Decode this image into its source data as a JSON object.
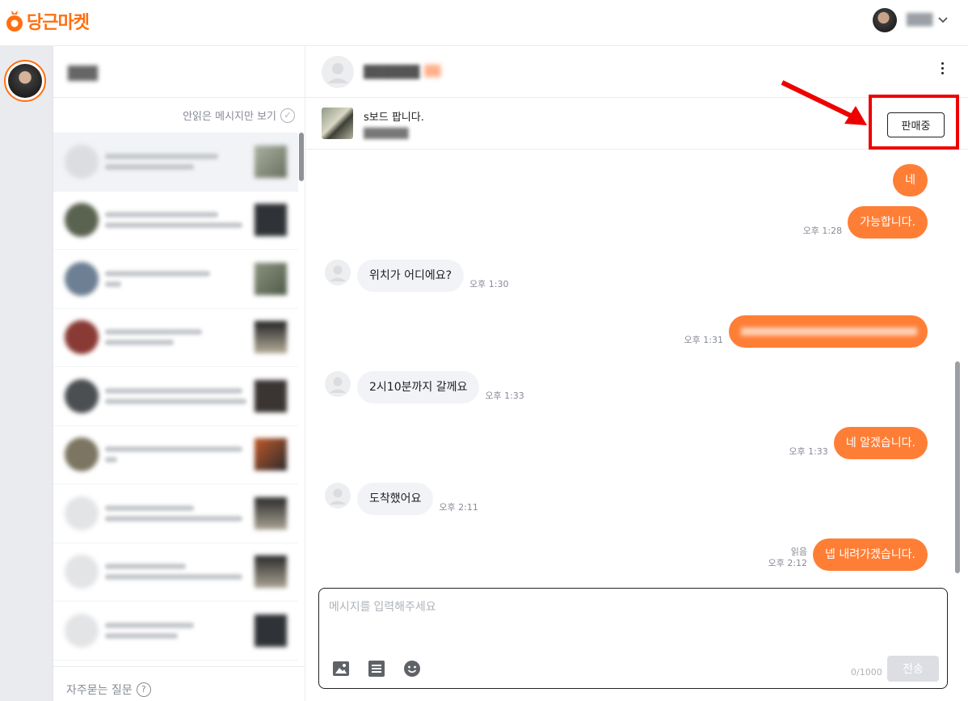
{
  "app": {
    "logo_text": "당근마켓",
    "brand_color": "#ff6f0f"
  },
  "topbar": {
    "user_name": "███"
  },
  "chat_list": {
    "title": "███",
    "unread_only_label": "안읽은 메시지만 보기",
    "faq_label": "자주묻는 질문",
    "item_count": 9
  },
  "chat": {
    "partner_name": "██████",
    "partner_temp": "██",
    "item": {
      "title": "s보드 팝니다.",
      "price": "██████"
    },
    "status_button": "판매중",
    "messages": [
      {
        "from": "me",
        "text": "네",
        "time": ""
      },
      {
        "from": "me",
        "text": "가능합니다.",
        "time": "오후 1:28"
      },
      {
        "from": "them",
        "text": "위치가 어디에요?",
        "time": "오후 1:30"
      },
      {
        "from": "me",
        "text": "",
        "time": "오후 1:31"
      },
      {
        "from": "them",
        "text": "2시10분까지 갈께요",
        "time": "오후 1:33"
      },
      {
        "from": "me",
        "text": "네 알겠습니다.",
        "time": "오후 1:33"
      },
      {
        "from": "them",
        "text": "도착했어요",
        "time": "오후 2:11"
      },
      {
        "from": "me",
        "text": "넵 내려가겠습니다.",
        "time": "오후 2:12",
        "read_label": "읽음"
      }
    ],
    "composer": {
      "placeholder": "메시지를 입력해주세요",
      "char_count": "0/1000",
      "send_label": "전송"
    }
  },
  "colors": {
    "my_bubble": "#ff7e36",
    "their_bubble": "#f2f3f6",
    "highlight": "#ee0000"
  }
}
